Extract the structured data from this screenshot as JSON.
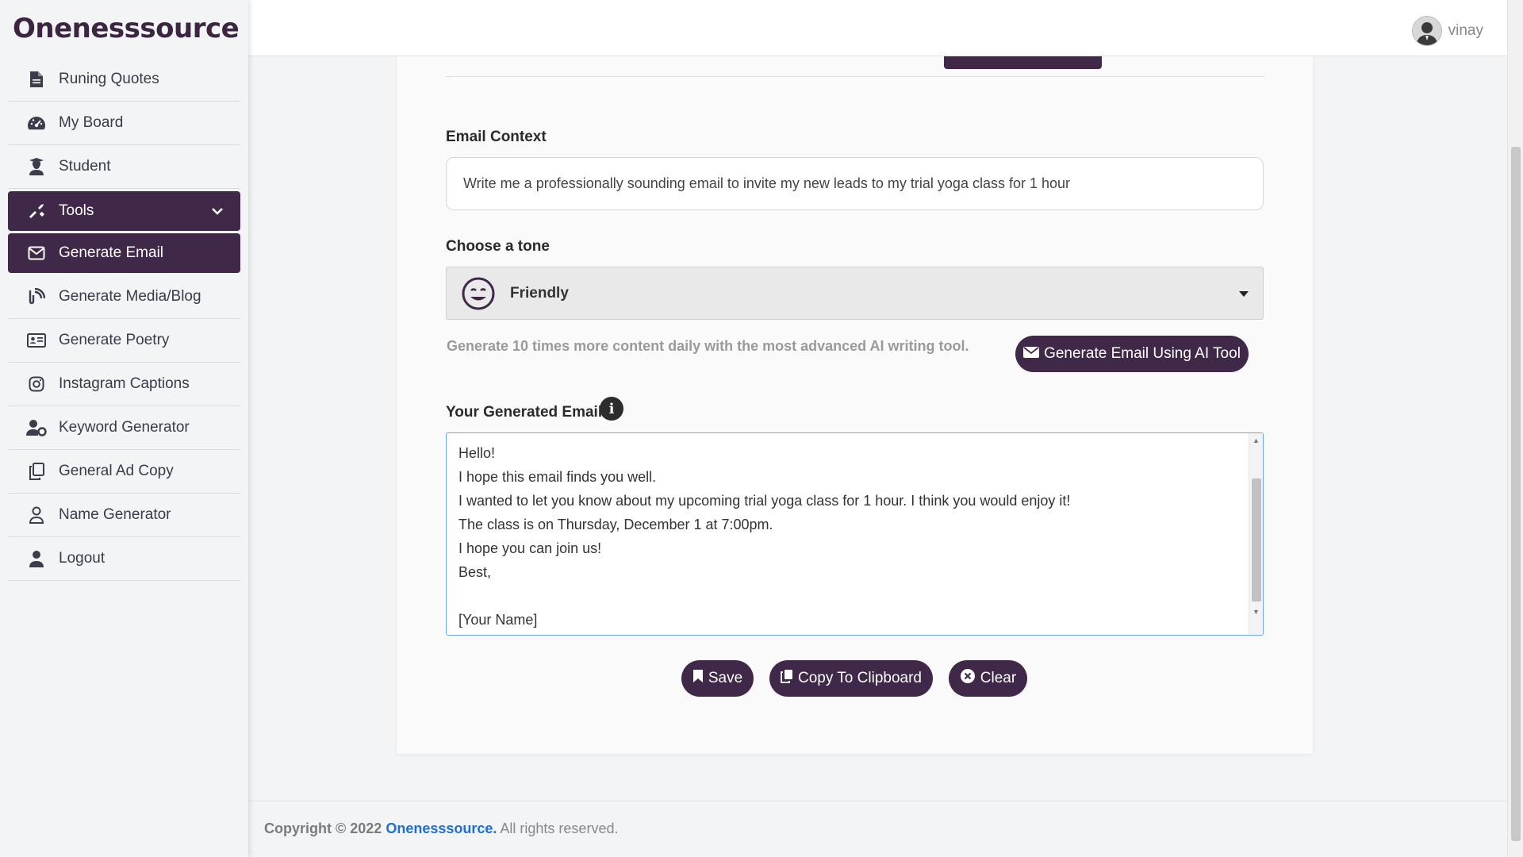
{
  "brand": "Onenesssource",
  "user": {
    "name": "vinay"
  },
  "sidebar": {
    "items": [
      {
        "label": "Runing Quotes",
        "icon": "file-icon"
      },
      {
        "label": "My Board",
        "icon": "dashboard-gauge-icon"
      },
      {
        "label": "Student",
        "icon": "student-icon"
      },
      {
        "label": "Tools",
        "icon": "tools-icon",
        "active": true,
        "expanded": true
      },
      {
        "label": "Generate Email",
        "icon": "envelope-icon",
        "active": true
      },
      {
        "label": "Generate Media/Blog",
        "icon": "blog-icon"
      },
      {
        "label": "Generate Poetry",
        "icon": "id-card-icon"
      },
      {
        "label": "Instagram Captions",
        "icon": "instagram-icon"
      },
      {
        "label": "Keyword Generator",
        "icon": "user-gear-icon"
      },
      {
        "label": "General Ad Copy",
        "icon": "copy-icon"
      },
      {
        "label": "Name Generator",
        "icon": "user-outline-icon"
      },
      {
        "label": "Logout",
        "icon": "user-icon"
      }
    ]
  },
  "form": {
    "context_label": "Email Context",
    "context_value": "Write me a professionally sounding email to invite my new leads to my trial yoga class for 1 hour",
    "tone_label": "Choose a tone",
    "tone_value": "Friendly",
    "promo_text": "Generate 10 times more content daily with the most advanced AI writing tool.",
    "generate_button": "Generate Email Using AI Tool",
    "output_label": "Your Generated Email",
    "output_lines": [
      "Hello!",
      "I hope this email finds you well.",
      "I wanted to let you know about my upcoming trial yoga class for 1 hour. I think you would enjoy it!",
      "The class is on Thursday, December 1 at 7:00pm.",
      "I hope you can join us!",
      "Best,",
      "",
      "[Your Name]"
    ]
  },
  "actions": {
    "save": "Save",
    "copy": "Copy To Clipboard",
    "clear": "Clear"
  },
  "footer": {
    "prefix": "Copyright © 2022",
    "brand": "Onenesssource.",
    "suffix": "All rights reserved."
  },
  "colors": {
    "primary": "#3f2848",
    "link": "#1f6fd1"
  }
}
